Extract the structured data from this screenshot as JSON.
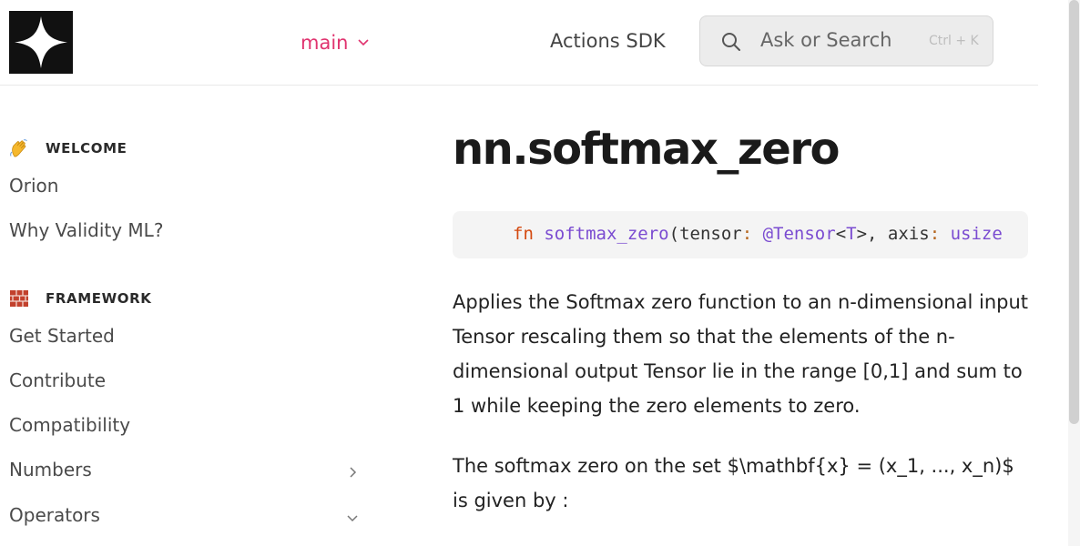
{
  "header": {
    "version": "main",
    "actions_link": "Actions SDK",
    "search_placeholder": "Ask or Search",
    "search_shortcut": "Ctrl + K"
  },
  "sidebar": {
    "sections": [
      {
        "title": "WELCOME",
        "icon": "waving-hand-emoji",
        "items": [
          {
            "label": "Orion"
          },
          {
            "label": "Why Validity ML?"
          }
        ]
      },
      {
        "title": "FRAMEWORK",
        "icon": "bricks-emoji",
        "items": [
          {
            "label": "Get Started"
          },
          {
            "label": "Contribute"
          },
          {
            "label": "Compatibility"
          },
          {
            "label": "Numbers",
            "chevron": "right"
          },
          {
            "label": "Operators",
            "chevron": "down"
          }
        ]
      }
    ]
  },
  "content": {
    "title": "nn.softmax_zero",
    "code": {
      "kw": "fn",
      "fname": "softmax_zero",
      "paren_open": "(",
      "p1": "tensor",
      "colon1": ":",
      "at_type": " @Tensor",
      "lt": "<",
      "tparam": "T",
      "gt_comma": ">, ",
      "p2": "axis",
      "colon2": ":",
      "t2": " usize"
    },
    "paragraphs": [
      "Applies the Softmax zero function to an n-dimensional input Tensor rescaling them so that the elements of the n-dimensional output Tensor lie in the range [0,1] and sum to 1 while keeping the zero elements to zero.",
      "The softmax zero on the set $\\mathbf{x} = (x_1, ..., x_n)$ is given by :"
    ]
  },
  "colors": {
    "accent": "#e0336f",
    "keyword": "#d4490f",
    "function": "#7a4bd1"
  }
}
